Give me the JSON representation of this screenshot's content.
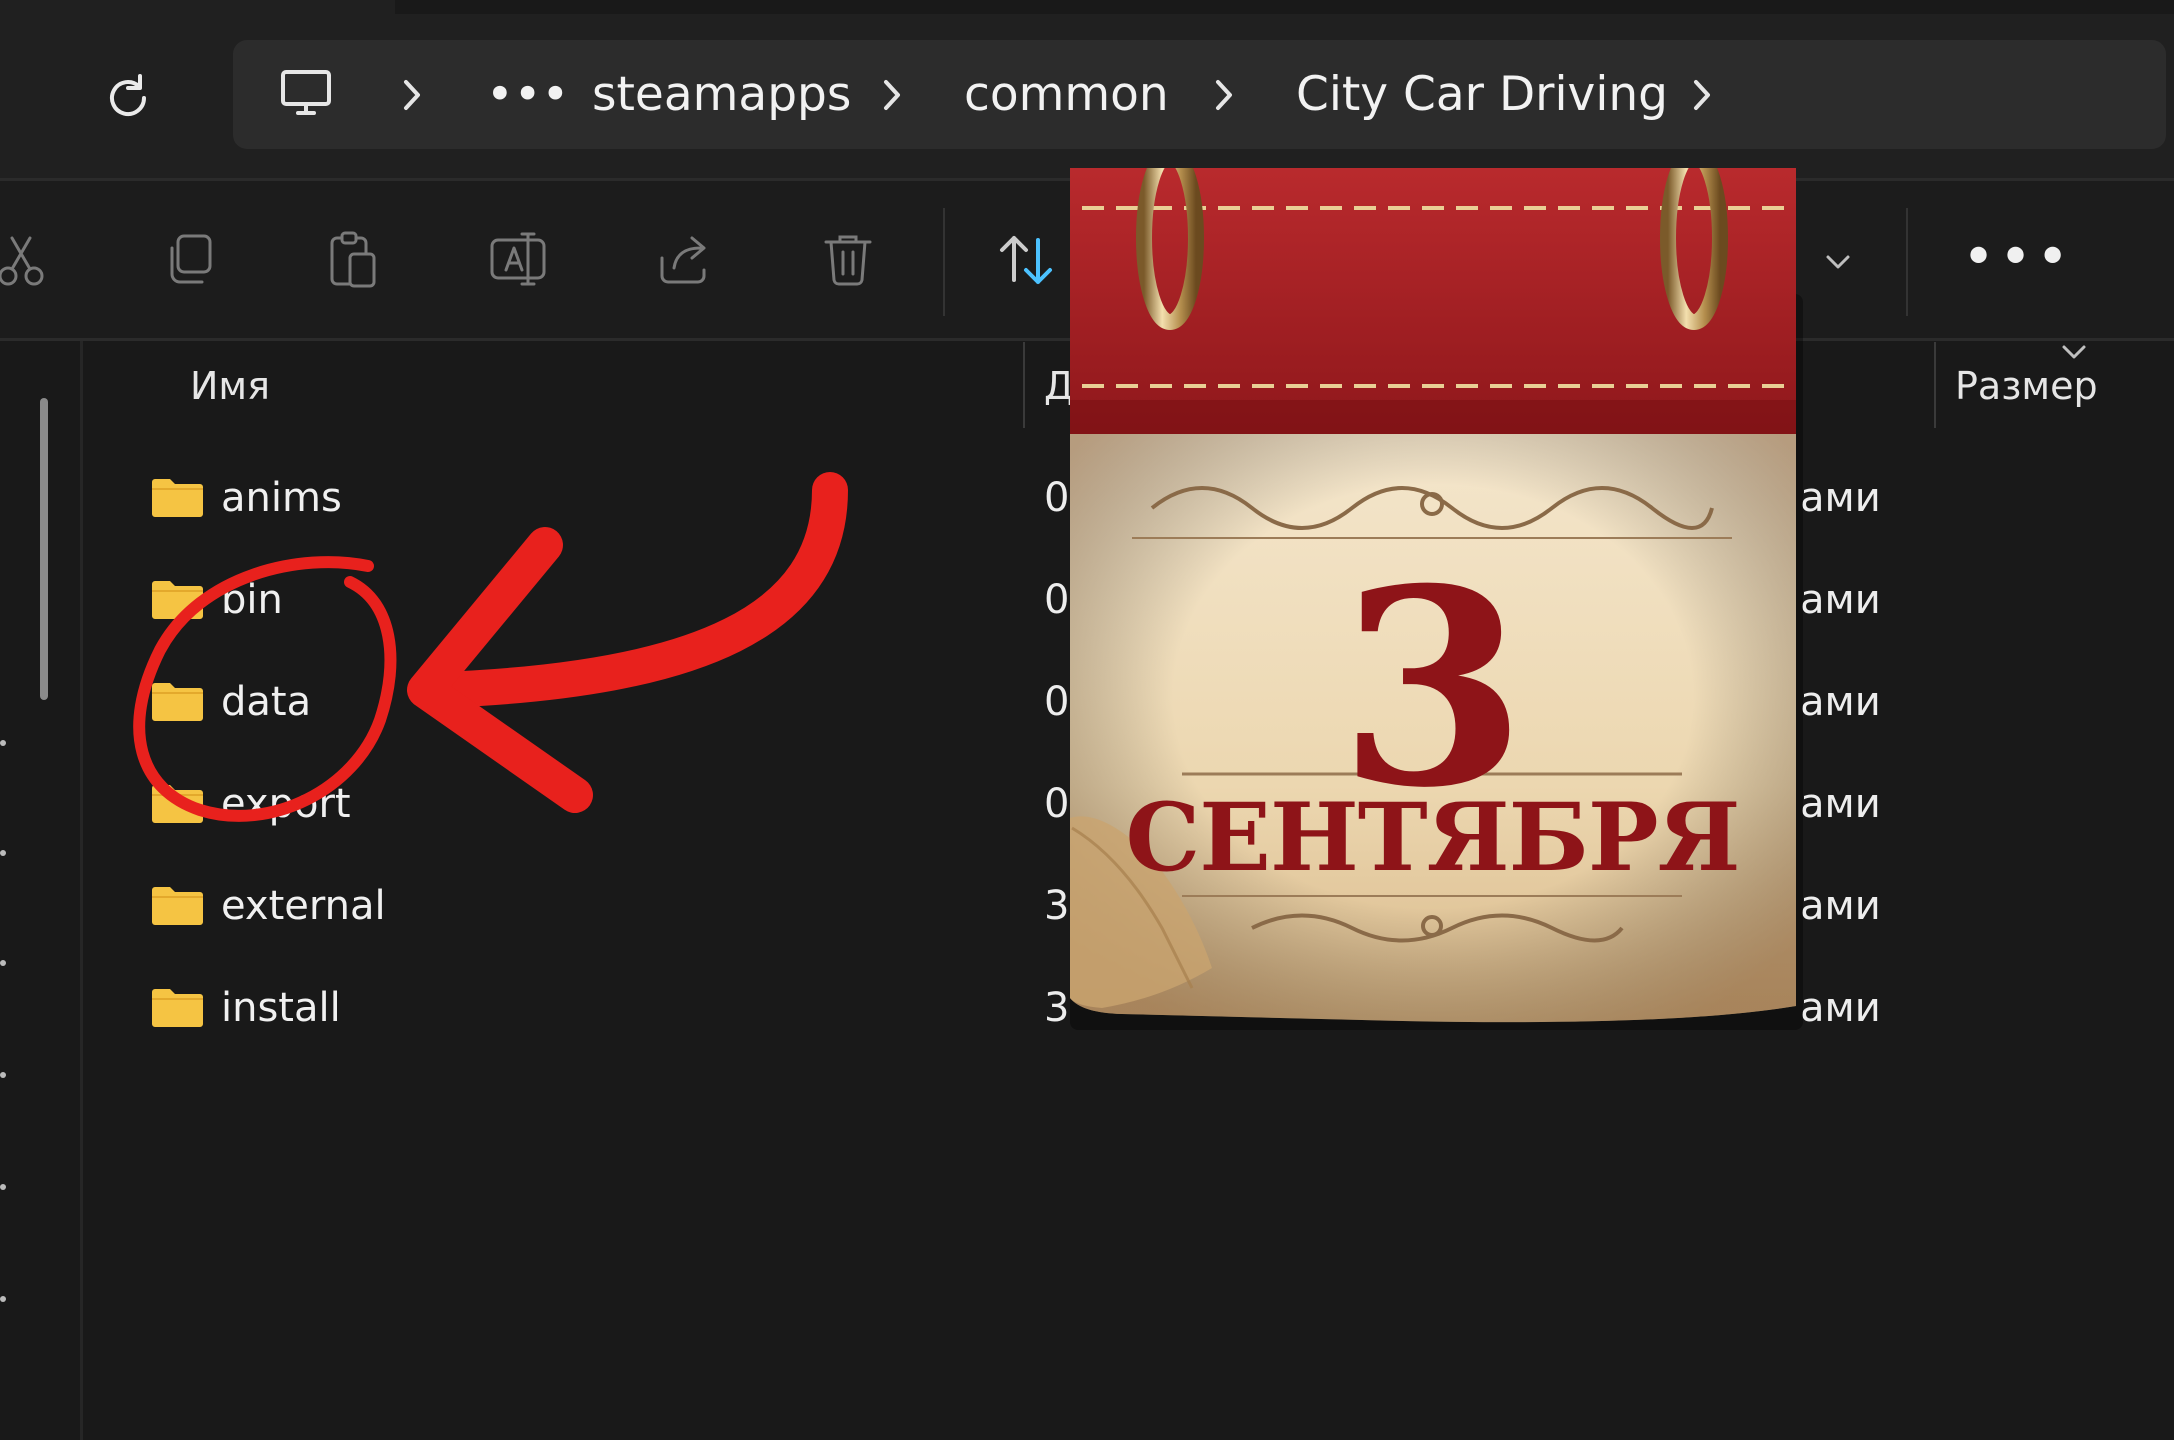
{
  "breadcrumb": {
    "items": [
      {
        "label": "steamapps"
      },
      {
        "label": "common"
      },
      {
        "label": "City Car Driving"
      }
    ],
    "overflow_label": "•••"
  },
  "toolbar": {
    "more_label": "•••"
  },
  "columns": {
    "name": "Имя",
    "date_partial": "Д",
    "size": "Размер"
  },
  "files": [
    {
      "name": "anims",
      "date_partial": "0",
      "type_partial": "ами"
    },
    {
      "name": "bin",
      "date_partial": "0",
      "type_partial": "ами"
    },
    {
      "name": "data",
      "date_partial": "0",
      "type_partial": "ами"
    },
    {
      "name": "export",
      "date_partial": "0",
      "type_partial": "ами"
    },
    {
      "name": "external",
      "date_partial": "3",
      "type_partial": "ами"
    },
    {
      "name": "install",
      "date_partial": "3",
      "type_partial": "ами"
    }
  ],
  "calendar": {
    "day": "3",
    "month": "СЕНТЯБРЯ"
  },
  "colors": {
    "background": "#191919",
    "folder": "#f5c443",
    "annotation_red": "#e8211d",
    "calendar_red": "#a71d22",
    "sort_blue": "#4cc2ff"
  }
}
